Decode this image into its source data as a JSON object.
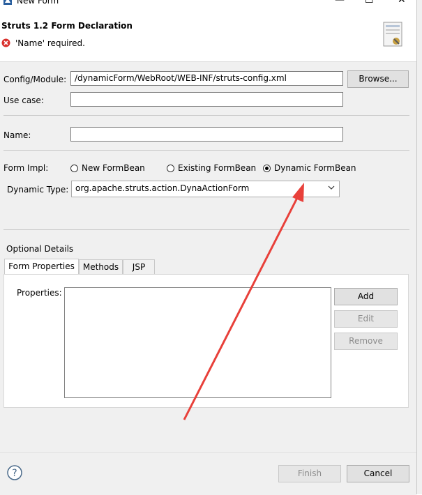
{
  "window": {
    "title": "New Form"
  },
  "header": {
    "title": "Struts 1.2 Form Declaration",
    "error_message": "'Name' required."
  },
  "form": {
    "config_module": {
      "label": "Config/Module:",
      "value": "/dynamicForm/WebRoot/WEB-INF/struts-config.xml",
      "browse_label": "Browse..."
    },
    "use_case": {
      "label": "Use case:",
      "value": ""
    },
    "name": {
      "label": "Name:",
      "value": ""
    },
    "form_impl": {
      "label": "Form Impl:",
      "options": [
        "New FormBean",
        "Existing FormBean",
        "Dynamic FormBean"
      ],
      "selected": "Dynamic FormBean"
    },
    "dynamic_type": {
      "label": "Dynamic Type:",
      "value": "org.apache.struts.action.DynaActionForm"
    }
  },
  "optional": {
    "title": "Optional Details",
    "tabs": [
      "Form Properties",
      "Methods",
      "JSP"
    ],
    "active_tab": "Form Properties",
    "properties_label": "Properties:",
    "buttons": {
      "add": "Add",
      "edit": "Edit",
      "remove": "Remove"
    }
  },
  "footer": {
    "finish_label": "Finish",
    "cancel_label": "Cancel"
  },
  "colors": {
    "error_red": "#d9302c",
    "annotation_arrow": "#e8403a"
  }
}
